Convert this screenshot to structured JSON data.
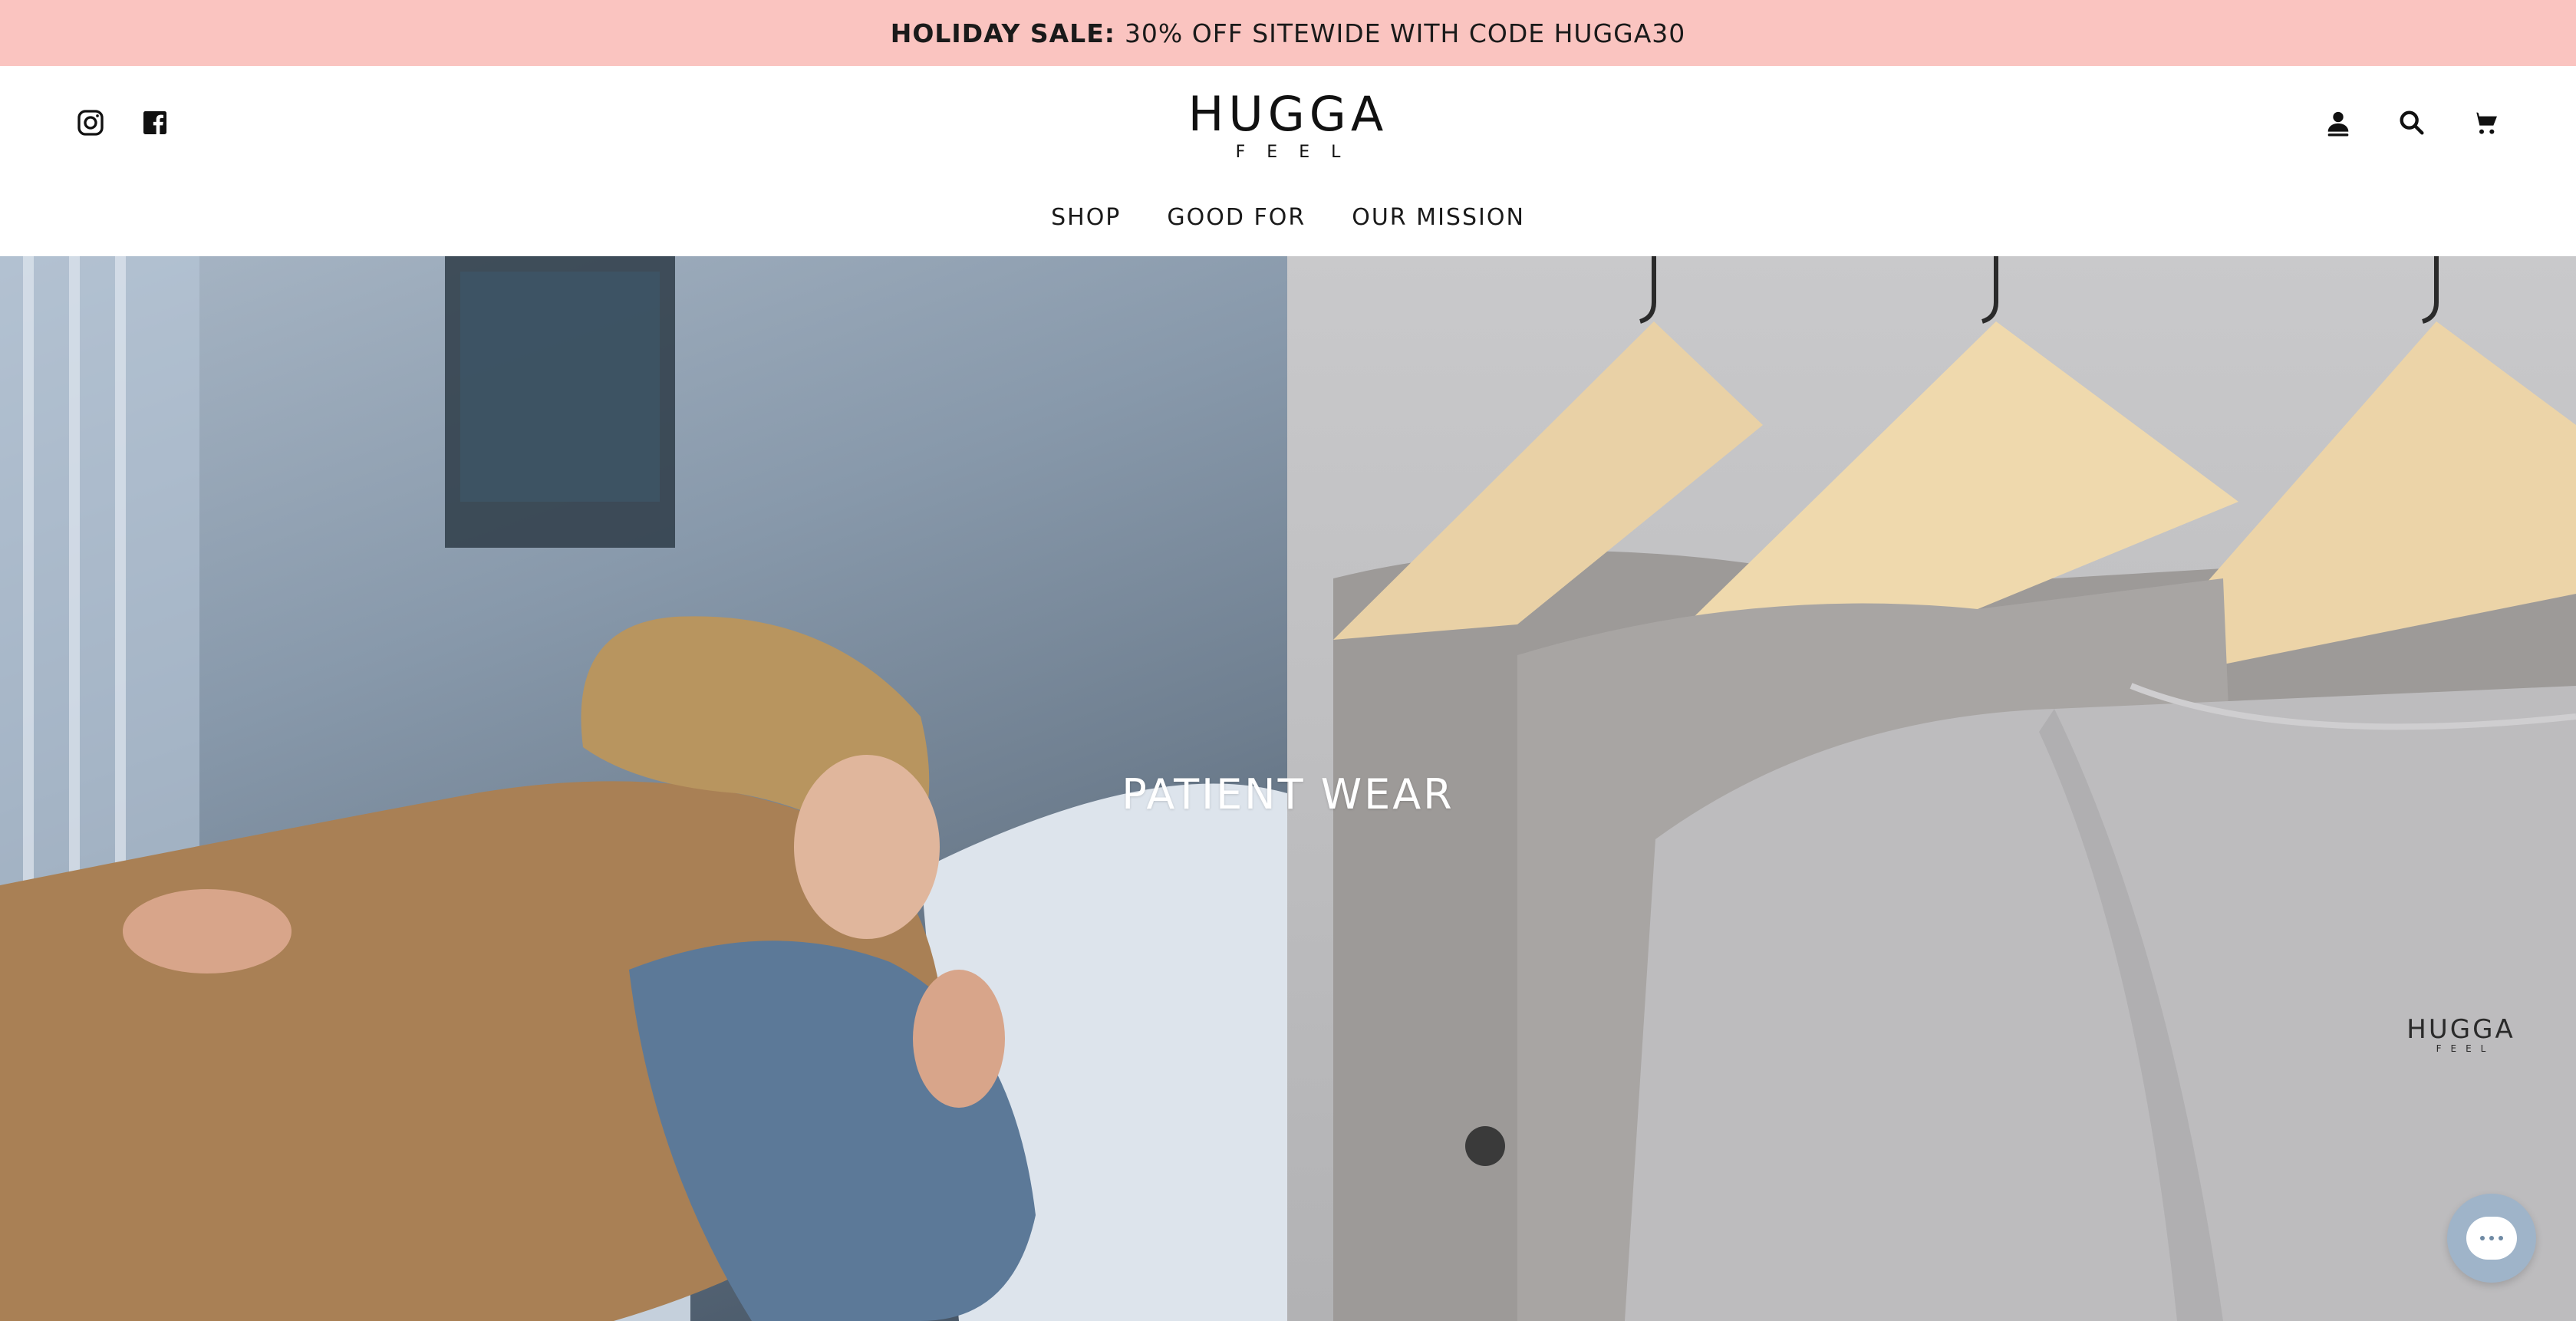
{
  "announcement": {
    "strong": "HOLIDAY SALE:",
    "text": "30% OFF SITEWIDE WITH CODE HUGGA30",
    "background": "#fac4c0"
  },
  "header": {
    "social": [
      "instagram-icon",
      "facebook-icon"
    ],
    "logo": {
      "word": "HUGGA",
      "sub": "FEEL"
    },
    "utility": [
      "account-icon",
      "search-icon",
      "cart-icon"
    ]
  },
  "nav": {
    "items": [
      {
        "label": "SHOP"
      },
      {
        "label": "GOOD FOR"
      },
      {
        "label": "OUR MISSION"
      }
    ]
  },
  "hero": {
    "title": "PATIENT WEAR",
    "garment_logo": {
      "word": "HUGGA",
      "sub": "FEEL"
    }
  },
  "chat": {
    "icon": "chat-icon",
    "color": "#9fb4c9"
  }
}
